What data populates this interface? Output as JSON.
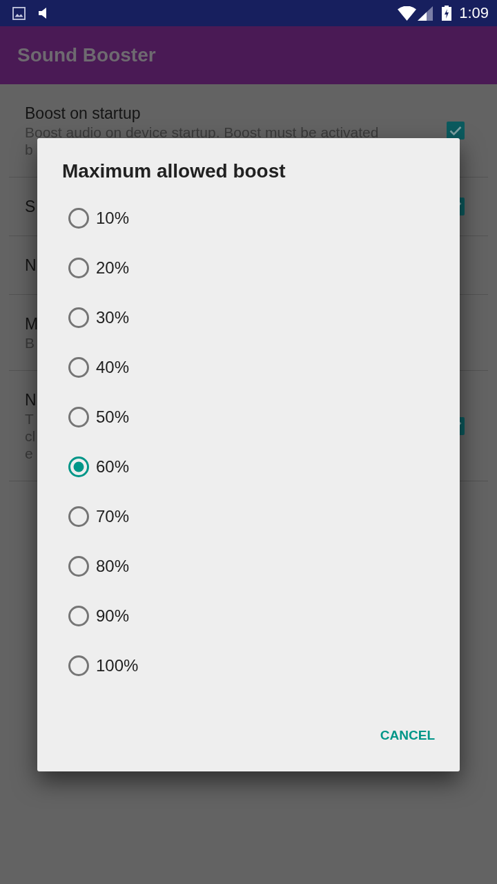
{
  "status_bar": {
    "time": "1:09"
  },
  "app_bar": {
    "title": "Sound Booster"
  },
  "settings": [
    {
      "kind": "checkbox",
      "title": "Boost on startup",
      "summary_lines": [
        "Boost audio on device startup. Boost must be activated",
        "b"
      ],
      "checked": true
    },
    {
      "kind": "checkbox",
      "title": "S",
      "checked": true
    },
    {
      "kind": "plain",
      "title": "N"
    },
    {
      "kind": "plain",
      "title": "M",
      "summary_lines": [
        "B"
      ]
    },
    {
      "kind": "checkbox",
      "title": "N",
      "summary_lines": [
        "T",
        "cl",
        "e"
      ],
      "checked": true
    }
  ],
  "dialog": {
    "title": "Maximum allowed boost",
    "options": [
      {
        "label": "10%",
        "selected": false
      },
      {
        "label": "20%",
        "selected": false
      },
      {
        "label": "30%",
        "selected": false
      },
      {
        "label": "40%",
        "selected": false
      },
      {
        "label": "50%",
        "selected": false
      },
      {
        "label": "60%",
        "selected": true
      },
      {
        "label": "70%",
        "selected": false
      },
      {
        "label": "80%",
        "selected": false
      },
      {
        "label": "90%",
        "selected": false
      },
      {
        "label": "100%",
        "selected": false
      }
    ],
    "buttons": [
      "CANCEL"
    ]
  }
}
